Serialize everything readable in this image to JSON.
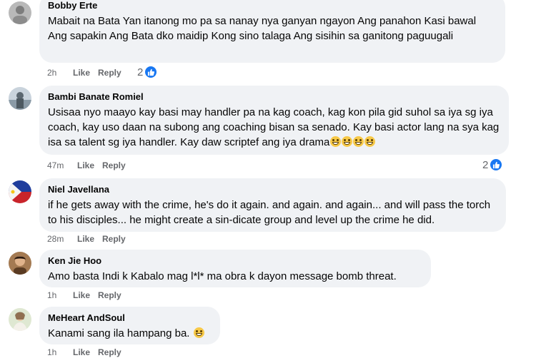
{
  "comments": [
    {
      "author": "Bobby Erte",
      "text": "Mabait na Bata Yan itanong mo pa sa nanay nya ganyan ngayon Ang panahon Kasi bawal Ang sapakin Ang Bata dko maidip Kong sino talaga Ang sisihin sa ganitong paguugali",
      "time": "2h",
      "like_label": "Like",
      "reply_label": "Reply",
      "reaction_count": "2"
    },
    {
      "author": "Bambi Banate Romiel",
      "text": "Usisaa nyo maayo kay basi may handler pa na kag coach, kag kon pila gid suhol sa iya sg iya coach, kay uso daan na subong ang coaching bisan sa senado. Kay basi actor lang na sya kag isa sa talent sg iya handler. Kay daw scriptef ang iya drama",
      "time": "47m",
      "like_label": "Like",
      "reply_label": "Reply",
      "reaction_count": "2"
    },
    {
      "author": "Niel Javellana",
      "text": "if he gets away with the crime, he's do it again. and again. and again... and will pass the torch to his disciples... he might create a sin-dicate group and level up the crime he did.",
      "time": "28m",
      "like_label": "Like",
      "reply_label": "Reply"
    },
    {
      "author": "Ken Jie Hoo",
      "text": "Amo basta Indi k Kabalo mag l*l* ma obra k dayon message bomb threat.",
      "time": "1h",
      "like_label": "Like",
      "reply_label": "Reply"
    },
    {
      "author": "MeHeart AndSoul",
      "text": "Kanami sang ila hampang ba.",
      "time": "1h",
      "like_label": "Like",
      "reply_label": "Reply"
    }
  ],
  "icons": {
    "reaction": "like-thumb-icon",
    "emoji": "grinning-face-emoji-icon"
  },
  "colors": {
    "bubble": "#f0f2f5",
    "meta": "#65676b",
    "like_blue": "#1877f2"
  }
}
